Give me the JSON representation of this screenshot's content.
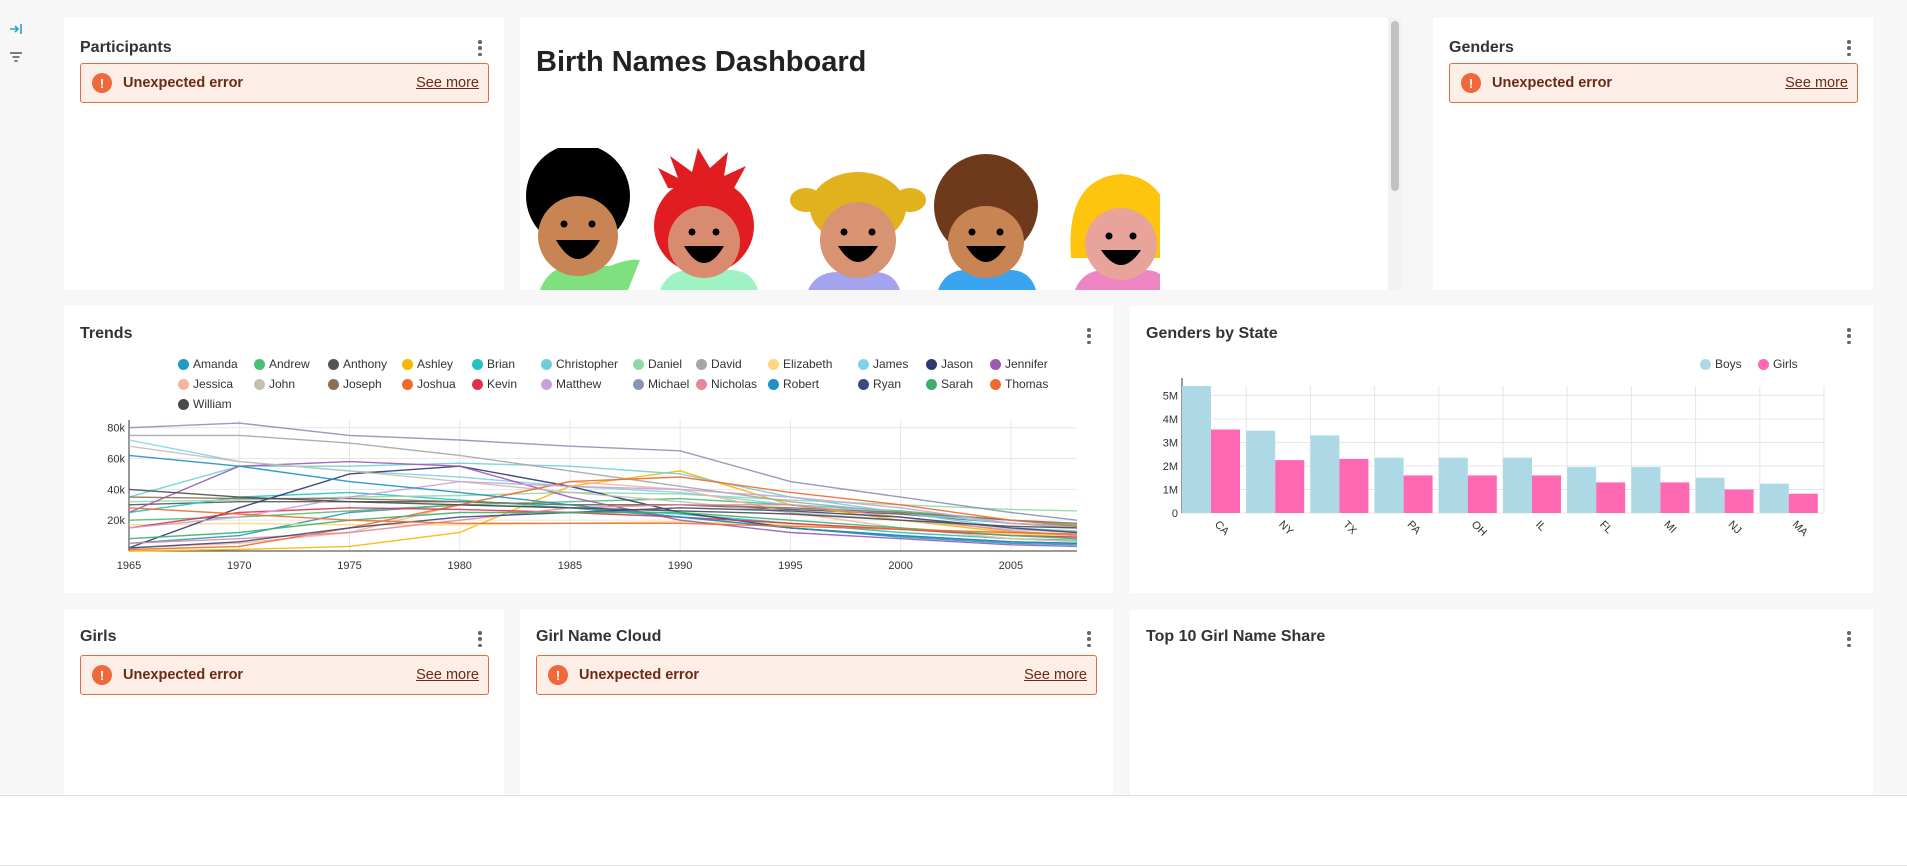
{
  "sidebar": {
    "expand_icon": "expand-arrow-icon",
    "filter_icon": "filter-icon"
  },
  "colors": {
    "error_border": "#e36b42",
    "error_bg": "#fdeee8",
    "boys": "#add8e6",
    "girls": "#ff69b4"
  },
  "cards": {
    "participants": {
      "title": "Participants",
      "error": "Unexpected error",
      "see_more": "See more"
    },
    "markdown": {
      "title": "Birth Names Dashboard"
    },
    "genders": {
      "title": "Genders",
      "error": "Unexpected error",
      "see_more": "See more"
    },
    "trends": {
      "title": "Trends"
    },
    "genders_by_state": {
      "title": "Genders by State"
    },
    "girls": {
      "title": "Girls",
      "error": "Unexpected error",
      "see_more": "See more"
    },
    "girl_name_cloud": {
      "title": "Girl Name Cloud",
      "error": "Unexpected error",
      "see_more": "See more"
    },
    "top10": {
      "title": "Top 10 Girl Name Share"
    }
  },
  "chart_data": [
    {
      "type": "line",
      "title": "Trends",
      "x_ticks": [
        1965,
        1970,
        1975,
        1980,
        1985,
        1990,
        1995,
        2000,
        2005
      ],
      "xlim": [
        1965,
        2008
      ],
      "y_ticks": [
        "20k",
        "40k",
        "60k",
        "80k"
      ],
      "ylim": [
        0,
        85000
      ],
      "grid": true,
      "legend_position": "top",
      "x": [
        1965,
        1970,
        1975,
        1980,
        1985,
        1990,
        1995,
        2000,
        2005,
        2008
      ],
      "series": [
        {
          "name": "Amanda",
          "color": "#1f9bc4",
          "values": [
            5000,
            10000,
            25000,
            30000,
            28000,
            22000,
            15000,
            9000,
            5000,
            4000
          ]
        },
        {
          "name": "Andrew",
          "color": "#4bbf73",
          "values": [
            20000,
            22000,
            26000,
            30000,
            32000,
            34000,
            30000,
            26000,
            20000,
            17000
          ]
        },
        {
          "name": "Anthony",
          "color": "#555555",
          "values": [
            30000,
            32000,
            32000,
            32000,
            30000,
            30000,
            27000,
            24000,
            18000,
            16000
          ]
        },
        {
          "name": "Ashley",
          "color": "#f5b800",
          "values": [
            0,
            1000,
            3000,
            12000,
            42000,
            52000,
            30000,
            20000,
            12000,
            10000
          ]
        },
        {
          "name": "Brian",
          "color": "#22c3c3",
          "values": [
            25000,
            35000,
            38000,
            33000,
            28000,
            24000,
            18000,
            12000,
            8000,
            7000
          ]
        },
        {
          "name": "Christopher",
          "color": "#6fcfd9",
          "values": [
            35000,
            55000,
            55000,
            57000,
            55000,
            50000,
            35000,
            25000,
            15000,
            13000
          ]
        },
        {
          "name": "Daniel",
          "color": "#8fd9a8",
          "values": [
            32000,
            33000,
            35000,
            36000,
            38000,
            37000,
            33000,
            30000,
            27000,
            26000
          ]
        },
        {
          "name": "David",
          "color": "#a6a6a6",
          "values": [
            75000,
            75000,
            70000,
            62000,
            52000,
            42000,
            32000,
            25000,
            18000,
            15000
          ]
        },
        {
          "name": "Elizabeth",
          "color": "#fcd77f",
          "values": [
            17000,
            18000,
            17000,
            17000,
            18000,
            19000,
            17000,
            15000,
            11000,
            9000
          ]
        },
        {
          "name": "James",
          "color": "#7fd3e6",
          "values": [
            72000,
            58000,
            52000,
            48000,
            42000,
            38000,
            30000,
            25000,
            18000,
            16000
          ]
        },
        {
          "name": "Jason",
          "color": "#2e3a6e",
          "values": [
            2000,
            28000,
            50000,
            55000,
            42000,
            25000,
            15000,
            10000,
            6000,
            5000
          ]
        },
        {
          "name": "Jennifer",
          "color": "#9b59b6",
          "values": [
            25000,
            55000,
            58000,
            55000,
            35000,
            20000,
            12000,
            8000,
            4000,
            3000
          ]
        },
        {
          "name": "Jessica",
          "color": "#f5b59a",
          "values": [
            2000,
            5000,
            12000,
            30000,
            45000,
            40000,
            25000,
            15000,
            8000,
            6000
          ]
        },
        {
          "name": "John",
          "color": "#c8bfb4",
          "values": [
            68000,
            58000,
            52000,
            45000,
            38000,
            32000,
            25000,
            20000,
            14000,
            12000
          ]
        },
        {
          "name": "Joseph",
          "color": "#8b6f55",
          "values": [
            35000,
            34000,
            34000,
            32000,
            30000,
            30000,
            28000,
            25000,
            20000,
            18000
          ]
        },
        {
          "name": "Joshua",
          "color": "#f06a2c",
          "values": [
            1000,
            3000,
            15000,
            30000,
            45000,
            48000,
            38000,
            30000,
            20000,
            16000
          ]
        },
        {
          "name": "Kevin",
          "color": "#e0314b",
          "values": [
            15000,
            25000,
            28000,
            27000,
            25000,
            22000,
            18000,
            14000,
            10000,
            9000
          ]
        },
        {
          "name": "Matthew",
          "color": "#c9a0dc",
          "values": [
            15000,
            22000,
            35000,
            45000,
            42000,
            40000,
            35000,
            28000,
            18000,
            15000
          ]
        },
        {
          "name": "Michael",
          "color": "#8892b3",
          "values": [
            80000,
            83000,
            75000,
            72000,
            68000,
            65000,
            45000,
            35000,
            25000,
            20000
          ]
        },
        {
          "name": "Nicholas",
          "color": "#e4879a",
          "values": [
            5000,
            8000,
            12000,
            20000,
            28000,
            30000,
            30000,
            22000,
            13000,
            10000
          ]
        },
        {
          "name": "Robert",
          "color": "#1f8fc4",
          "values": [
            62000,
            55000,
            45000,
            38000,
            30000,
            22000,
            15000,
            10000,
            6000,
            5000
          ]
        },
        {
          "name": "Ryan",
          "color": "#3a4a7a",
          "values": [
            2000,
            6000,
            15000,
            22000,
            25000,
            28000,
            26000,
            22000,
            15000,
            12000
          ]
        },
        {
          "name": "Sarah",
          "color": "#3fae6c",
          "values": [
            8000,
            12000,
            20000,
            25000,
            25000,
            25000,
            20000,
            15000,
            10000,
            8000
          ]
        },
        {
          "name": "Thomas",
          "color": "#ef6b2f",
          "values": [
            28000,
            24000,
            20000,
            18000,
            18000,
            18000,
            16000,
            14000,
            12000,
            11000
          ]
        },
        {
          "name": "William",
          "color": "#4a4a4a",
          "values": [
            40000,
            35000,
            32000,
            30000,
            28000,
            26000,
            24000,
            20000,
            16000,
            15000
          ]
        }
      ]
    },
    {
      "type": "bar",
      "title": "Genders by State",
      "categories": [
        "CA",
        "NY",
        "TX",
        "PA",
        "OH",
        "IL",
        "FL",
        "MI",
        "NJ",
        "MA"
      ],
      "y_ticks": [
        "0",
        "1M",
        "2M",
        "3M",
        "4M",
        "5M"
      ],
      "ylim": [
        0,
        5000000
      ],
      "grid": true,
      "legend_position": "top-right",
      "series": [
        {
          "name": "Boys",
          "color": "#add8e6",
          "values": [
            5400000,
            3500000,
            3300000,
            2350000,
            2350000,
            2350000,
            1950000,
            1950000,
            1500000,
            1250000
          ]
        },
        {
          "name": "Girls",
          "color": "#ff69b4",
          "values": [
            3550000,
            2250000,
            2300000,
            1600000,
            1600000,
            1600000,
            1300000,
            1300000,
            1000000,
            820000
          ]
        }
      ]
    }
  ]
}
